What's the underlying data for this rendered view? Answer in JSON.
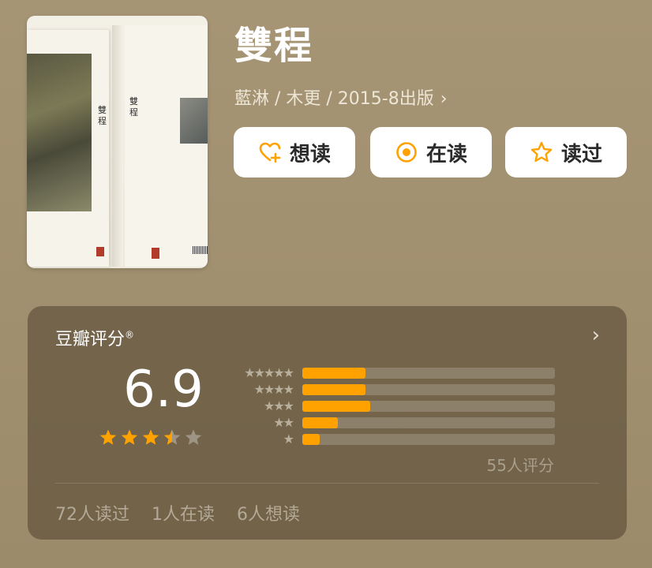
{
  "book": {
    "title": "雙程",
    "meta": "藍淋 / 木更 / 2015-8出版"
  },
  "cover": {
    "left_vertical_title": "雙程",
    "right_vertical_title": "雙程"
  },
  "actions": [
    {
      "label": "想读",
      "icon": "heart-plus-icon"
    },
    {
      "label": "在读",
      "icon": "target-circle-icon"
    },
    {
      "label": "读过",
      "icon": "star-outline-icon"
    }
  ],
  "rating": {
    "header": "豆瓣评分",
    "registered_mark": "®",
    "score": "6.9",
    "star_value": 3.5,
    "count_label": "55人评分",
    "distribution": [
      {
        "stars": 5,
        "percent": 25
      },
      {
        "stars": 4,
        "percent": 25
      },
      {
        "stars": 3,
        "percent": 27
      },
      {
        "stars": 2,
        "percent": 14
      },
      {
        "stars": 1,
        "percent": 7
      }
    ]
  },
  "stats": {
    "read": "72人读过",
    "reading": "1人在读",
    "want": "6人想读"
  },
  "colors": {
    "accent": "#ffa200",
    "background": "#a69575",
    "card": "#6b5d45"
  }
}
